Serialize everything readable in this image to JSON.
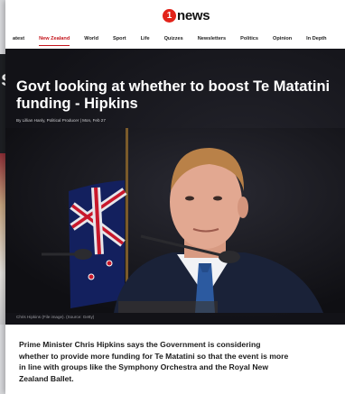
{
  "logo": {
    "mark": "1",
    "text": "news"
  },
  "nav": {
    "items": [
      "atest",
      "New Zealand",
      "World",
      "Sport",
      "Life",
      "Quizzes",
      "Newsletters",
      "Politics",
      "Opinion",
      "In Depth"
    ],
    "active_index": 1
  },
  "article": {
    "headline": "Govt looking at whether to boost Te Matatini funding - Hipkins",
    "byline": "By Lillian Hanly, Political Producer  |  Mon, Feb 27",
    "caption": "Chris Hipkins (File image). (Source: Getty)",
    "summary": "Prime Minister Chris Hipkins says the Government is considering whether to provide more funding for Te Matatini so that the event is more in line with groups like the Symphony Orchestra and the Royal New Zealand Ballet."
  },
  "background_card": {
    "letter": "s"
  },
  "colors": {
    "accent": "#c4151c",
    "logo_red": "#e2231a",
    "hero_bg": "#121217"
  }
}
